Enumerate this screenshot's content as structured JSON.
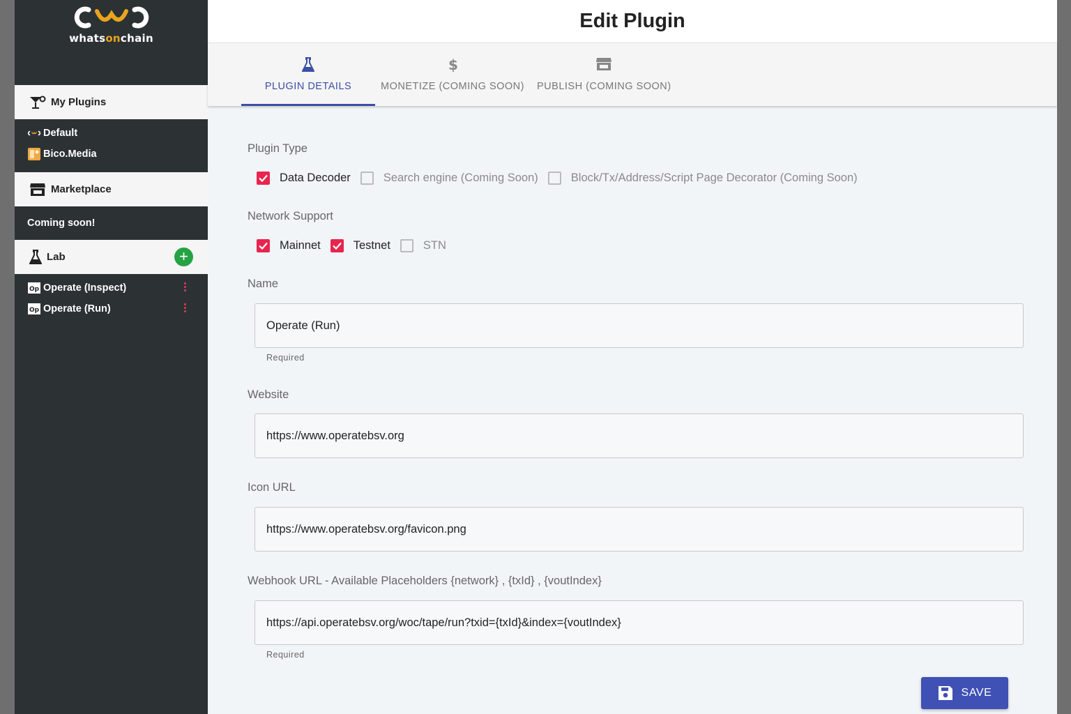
{
  "app": {
    "logo_text_pre": "whats",
    "logo_text_on": "on",
    "logo_text_post": "chain"
  },
  "sidebar": {
    "my_plugins": {
      "label": "My Plugins",
      "icon": "cocktail-icon",
      "items": [
        {
          "label": "Default",
          "icon": "woc-logo-icon"
        },
        {
          "label": "Bico.Media",
          "icon": "bico-media-icon"
        }
      ]
    },
    "marketplace": {
      "label": "Marketplace",
      "icon": "store-icon",
      "status": "Coming soon!"
    },
    "lab": {
      "label": "Lab",
      "icon": "flask-icon",
      "add_label": "+",
      "items": [
        {
          "label": "Operate (Inspect)",
          "icon": "op-icon"
        },
        {
          "label": "Operate (Run)",
          "icon": "op-icon"
        }
      ]
    }
  },
  "page": {
    "title": "Edit Plugin"
  },
  "tabs": [
    {
      "label": "PLUGIN DETAILS",
      "icon": "flask-icon",
      "active": true
    },
    {
      "label": "MONETIZE (COMING SOON)",
      "icon": "dollar-icon",
      "active": false
    },
    {
      "label": "PUBLISH (COMING SOON)",
      "icon": "store-icon",
      "active": false
    }
  ],
  "form": {
    "plugin_type": {
      "label": "Plugin Type",
      "options": [
        {
          "label": "Data Decoder",
          "checked": true
        },
        {
          "label": "Search engine (Coming Soon)",
          "checked": false
        },
        {
          "label": "Block/Tx/Address/Script Page Decorator (Coming Soon)",
          "checked": false
        }
      ]
    },
    "network_support": {
      "label": "Network Support",
      "options": [
        {
          "label": "Mainnet",
          "checked": true
        },
        {
          "label": "Testnet",
          "checked": true
        },
        {
          "label": "STN",
          "checked": false
        }
      ]
    },
    "name": {
      "label": "Name",
      "value": "Operate (Run)",
      "helper": "Required"
    },
    "website": {
      "label": "Website",
      "value": "https://www.operatebsv.org"
    },
    "icon_url": {
      "label": "Icon URL",
      "value": "https://www.operatebsv.org/favicon.png"
    },
    "webhook": {
      "label": "Webhook URL - Available Placeholders {network} , {txId} , {voutIndex}",
      "value": "https://api.operatebsv.org/woc/tape/run?txid={txId}&index={voutIndex}",
      "helper": "Required"
    },
    "save_label": "SAVE"
  },
  "colors": {
    "accent": "#3f51b5",
    "checkbox": "#e8254e",
    "sidebar": "#2c3134",
    "add_button": "#25a244",
    "logo_orange": "#e8a51c"
  }
}
